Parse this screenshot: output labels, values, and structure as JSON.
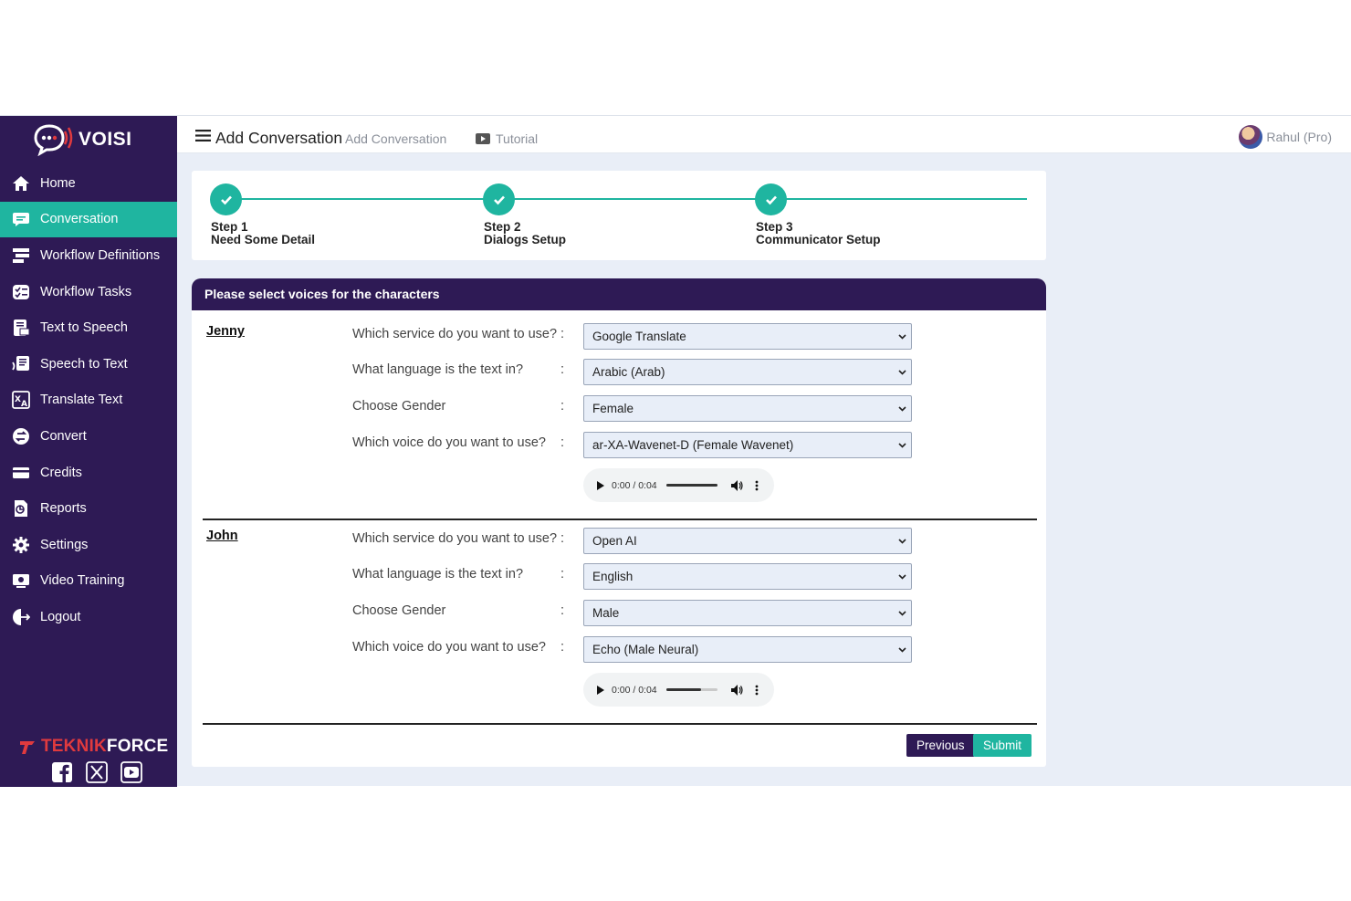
{
  "app": {
    "logo_text": "VOISI",
    "brand_text_red": "TEKNIK",
    "brand_text_white": "FORCE"
  },
  "sidebar": {
    "items": [
      {
        "label": "Home",
        "icon": "home-icon",
        "active": false
      },
      {
        "label": "Conversation",
        "icon": "chat-icon",
        "active": true
      },
      {
        "label": "Workflow Definitions",
        "icon": "workflow-icon",
        "active": false
      },
      {
        "label": "Workflow Tasks",
        "icon": "tasks-icon",
        "active": false
      },
      {
        "label": "Text to Speech",
        "icon": "text-to-speech-icon",
        "active": false
      },
      {
        "label": "Speech to Text",
        "icon": "speech-to-text-icon",
        "active": false
      },
      {
        "label": "Translate Text",
        "icon": "translate-icon",
        "active": false
      },
      {
        "label": "Convert",
        "icon": "convert-icon",
        "active": false
      },
      {
        "label": "Credits",
        "icon": "credit-card-icon",
        "active": false
      },
      {
        "label": "Reports",
        "icon": "reports-icon",
        "active": false
      },
      {
        "label": "Settings",
        "icon": "gear-icon",
        "active": false
      },
      {
        "label": "Video Training",
        "icon": "video-icon",
        "active": false
      },
      {
        "label": "Logout",
        "icon": "logout-icon",
        "active": false
      }
    ]
  },
  "header": {
    "title": "Add Conversation",
    "breadcrumb": "Add Conversation",
    "tutorial": "Tutorial",
    "user": "Rahul (Pro)"
  },
  "steps": [
    {
      "step": "Step 1",
      "label": "Need Some Detail"
    },
    {
      "step": "Step 2",
      "label": "Dialogs Setup"
    },
    {
      "step": "Step 3",
      "label": "Communicator Setup"
    }
  ],
  "form": {
    "heading": "Please select voices for the characters",
    "characters": [
      {
        "name": "Jenny",
        "rows": [
          {
            "label": "Which service do you want to use?",
            "value": "Google Translate"
          },
          {
            "label": "What language is the text in?",
            "value": "Arabic (Arab)"
          },
          {
            "label": "Choose Gender",
            "value": "Female"
          },
          {
            "label": "Which voice do you want to use?",
            "value": "ar-XA-Wavenet-D (Female Wavenet)"
          }
        ],
        "audio": {
          "time": "0:00 / 0:04",
          "volume": 1.0
        }
      },
      {
        "name": "John",
        "rows": [
          {
            "label": "Which service do you want to use?",
            "value": "Open AI"
          },
          {
            "label": "What language is the text in?",
            "value": "English"
          },
          {
            "label": "Choose Gender",
            "value": "Male"
          },
          {
            "label": "Which voice do you want to use?",
            "value": "Echo (Male Neural)"
          }
        ],
        "audio": {
          "time": "0:00 / 0:04",
          "volume": 0.68
        }
      }
    ],
    "colon": ":",
    "previous_label": "Previous",
    "submit_label": "Submit"
  },
  "colors": {
    "sidebar": "#2e1a55",
    "accent": "#1fb5a0",
    "background": "#e9eef7"
  }
}
